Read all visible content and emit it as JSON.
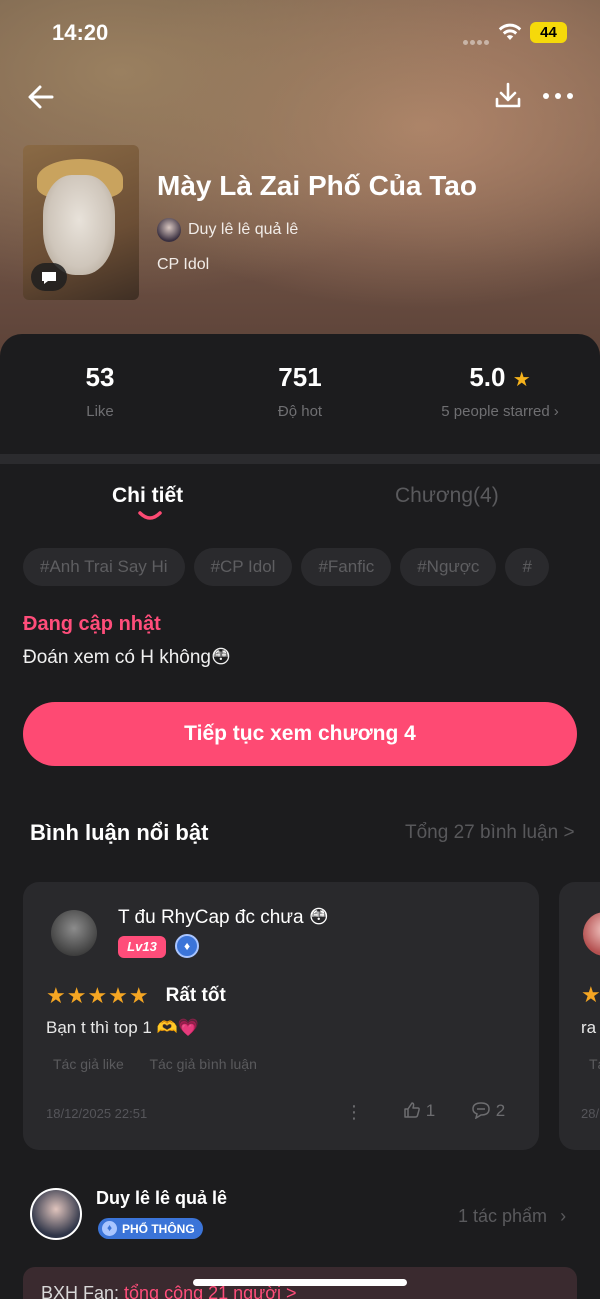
{
  "status_bar": {
    "time": "14:20",
    "battery": "44"
  },
  "header": {
    "back_icon": "arrow-left-icon",
    "download_icon": "download-icon",
    "more_icon": "more-horizontal-icon"
  },
  "book": {
    "title": "Mày Là Zai Phố Của Tao",
    "author": "Duy lê lê quả lê",
    "category": "CP Idol"
  },
  "stats": {
    "like_value": "53",
    "like_label": "Like",
    "hot_value": "751",
    "hot_label": "Độ hot",
    "rating_value": "5.0",
    "rating_label": "5 people starred"
  },
  "tabs": {
    "detail": "Chi tiết",
    "chapters": "Chương(4)"
  },
  "tags": [
    "#Anh Trai Say Hi",
    "#CP Idol",
    "#Fanfic",
    "#Ngược",
    "#"
  ],
  "status": {
    "update_label": "Đang cập nhật",
    "description": "Đoán xem có H không😳"
  },
  "continue_button": "Tiếp tục xem chương 4",
  "comments": {
    "title": "Bình luận nổi bật",
    "total": "Tổng 27 bình luận >",
    "items": [
      {
        "user": "T đu RhyCap đc chưa 😳",
        "level": "Lv13",
        "stars": "★★★★★",
        "rating_label": "Rất tốt",
        "text": "Bạn t thì top 1 🫶💗",
        "tag_author_like": "Tác giả like",
        "tag_author_comment": "Tác giả bình luận",
        "date": "18/12/2025 22:51",
        "likes": "1",
        "replies": "2"
      },
      {
        "star": "★",
        "text": "ra",
        "tag": "Tá",
        "date": "28/"
      }
    ]
  },
  "author_card": {
    "name": "Duy lê lê quả lê",
    "badge": "PHỔ THÔNG",
    "works": "1 tác phẩm"
  },
  "fan_banner": {
    "label": "BXH Fan: ",
    "count": "tổng cộng 21 người >"
  },
  "colors": {
    "accent": "#fe4a73",
    "background": "#1c1c1e",
    "star": "#f5a623",
    "badge_blue": "#3b74d8"
  }
}
